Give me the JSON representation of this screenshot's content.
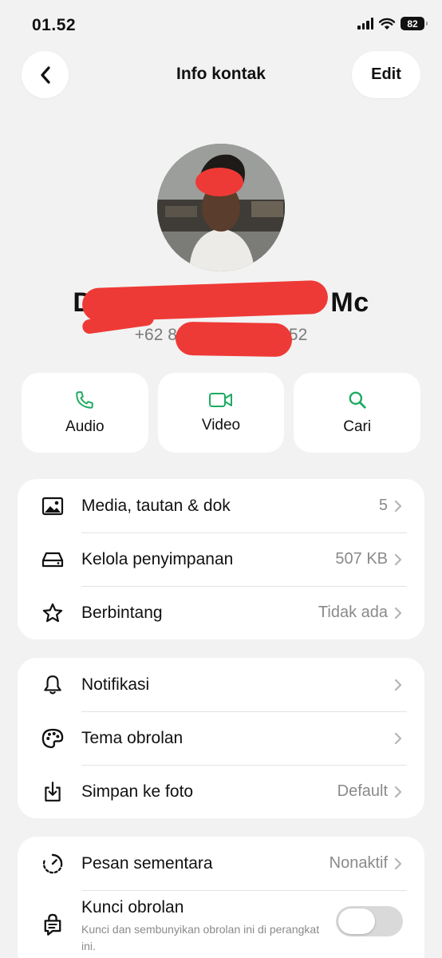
{
  "status_bar": {
    "time": "01.52",
    "battery": "82"
  },
  "nav": {
    "back_icon": "chevron-left-icon",
    "title": "Info kontak",
    "edit_label": "Edit"
  },
  "contact": {
    "name_start": "D",
    "name_end": "Mc",
    "phone_start": "+62 8",
    "phone_end": "52"
  },
  "actions": [
    {
      "icon": "phone-icon",
      "label": "Audio"
    },
    {
      "icon": "video-icon",
      "label": "Video"
    },
    {
      "icon": "search-icon",
      "label": "Cari"
    }
  ],
  "section1": [
    {
      "icon": "image-icon",
      "label": "Media, tautan & dok",
      "value": "5"
    },
    {
      "icon": "storage-icon",
      "label": "Kelola penyimpanan",
      "value": "507 KB"
    },
    {
      "icon": "star-icon",
      "label": "Berbintang",
      "value": "Tidak ada"
    }
  ],
  "section2": [
    {
      "icon": "bell-icon",
      "label": "Notifikasi",
      "value": ""
    },
    {
      "icon": "palette-icon",
      "label": "Tema obrolan",
      "value": ""
    },
    {
      "icon": "save-download-icon",
      "label": "Simpan ke foto",
      "value": "Default"
    }
  ],
  "section3": {
    "disappearing": {
      "icon": "timer-icon",
      "label": "Pesan sementara",
      "value": "Nonaktif"
    },
    "lock": {
      "icon": "chat-lock-icon",
      "label": "Kunci obrolan",
      "description": "Kunci dan sembunyikan obrolan ini di perangkat ini.",
      "enabled": false
    }
  },
  "colors": {
    "accent_green": "#1daa61",
    "background": "#f2f2f2",
    "redaction": "#ee3a36"
  }
}
